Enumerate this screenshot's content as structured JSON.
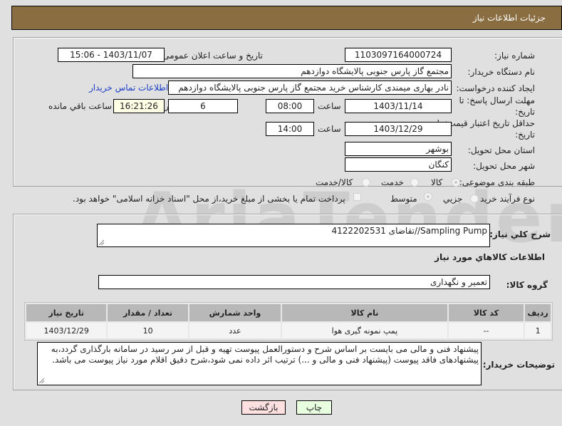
{
  "header": {
    "title": "جزئیات اطلاعات نیاز"
  },
  "fields": {
    "need_number_label": "شماره نیاز:",
    "need_number": "1103097164000724",
    "announce_label": "تاریخ و ساعت اعلان عمومی:",
    "announce_value": "1403/11/07 - 15:06",
    "buyer_org_label": "نام دستگاه خریدار:",
    "buyer_org": "مجتمع گاز پارس جنوبی  پالایشگاه دوازدهم",
    "creator_label": "ایجاد کننده درخواست:",
    "creator": "نادر بهاری میمندی کارشناس خرید مجتمع گاز پارس جنوبی  پالایشگاه دوازدهم",
    "buyer_contact_link": "اطلاعات تماس خریدار",
    "deadline_label_1": "مهلت ارسال پاسخ: تا",
    "deadline_label_2": "تاریخ:",
    "deadline_date": "1403/11/14",
    "time_label": "ساعت",
    "deadline_time": "08:00",
    "days_value": "6",
    "days_label": "روز و",
    "remaining_time": "16:21:26",
    "remaining_label": "ساعت باقي مانده",
    "validity_label_1": "حداقل تاریخ اعتبار قیمت: تا",
    "validity_label_2": "تاریخ:",
    "validity_date": "1403/12/29",
    "validity_time": "14:00",
    "province_label": "استان محل تحویل:",
    "province": "بوشهر",
    "city_label": "شهر محل تحویل:",
    "city": "کنگان",
    "category_label": "طبقه بندی موضوعی:",
    "category_options": [
      "کالا",
      "خدمت",
      "کالا/خدمت"
    ],
    "category_selected": "کالا",
    "process_label": "نوع فرآیند خرید :",
    "process_options": [
      "جزیي",
      "متوسط"
    ],
    "process_selected": "متوسط",
    "treasury_text": "پرداخت تمام یا بخشی از مبلغ خرید،از محل \"اسناد خزانه اسلامی\" خواهد بود."
  },
  "description": {
    "label": "شرح كلي نياز:",
    "value": "Sampling Pump//تقاضای 4122202531"
  },
  "goods": {
    "section_title": "اطلاعات كالاهاي مورد نياز",
    "group_label": "گروه کالا:",
    "group_value": "تعمیر و نگهداری",
    "columns": [
      "ردیف",
      "کد کالا",
      "نام کالا",
      "واحد شمارش",
      "تعداد / مقدار",
      "تاریخ نیاز"
    ],
    "rows": [
      {
        "row": "1",
        "code": "--",
        "name": "پمپ نمونه گیری هوا",
        "unit": "عدد",
        "qty": "10",
        "date": "1403/12/29"
      }
    ]
  },
  "buyer_notes": {
    "label": "توضیحات خریدار:",
    "value": "پیشنهاد فنی و مالی می بایست بر اساس شرح و دستورالعمل پیوست تهیه و قبل از سر رسید در سامانه بارگذاری گردد،به پیشنهادهای فاقد پیوست (پیشنهاد فنی و مالی و ...) ترتیب اثر داده نمی شود،شرح دقیق اقلام مورد نیاز پیوست می باشد."
  },
  "buttons": {
    "print": "چاپ",
    "back": "بازگشت"
  },
  "watermark": "AriaTender.neT"
}
